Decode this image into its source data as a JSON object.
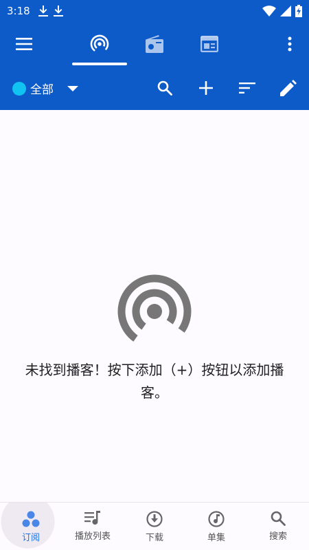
{
  "status_bar": {
    "time": "3:18",
    "icons": [
      "download-icon",
      "download-icon",
      "wifi-icon",
      "signal-icon",
      "battery-charging-icon"
    ]
  },
  "top_tabs": [
    {
      "icon": "podcast-icon",
      "selected": true
    },
    {
      "icon": "radio-icon",
      "selected": false
    },
    {
      "icon": "episodes-icon",
      "selected": false
    }
  ],
  "filter": {
    "label": "全部",
    "dot_color": "#11c3f0"
  },
  "toolbar_actions": [
    "search-icon",
    "add-icon",
    "sort-icon",
    "edit-icon"
  ],
  "empty_state": {
    "message": "未找到播客！按下添加（+）按钮以添加播客。"
  },
  "bottom_nav": [
    {
      "label": "订阅",
      "icon": "subscriptions-icon",
      "active": true
    },
    {
      "label": "播放列表",
      "icon": "playlist-icon",
      "active": false
    },
    {
      "label": "下载",
      "icon": "download-circle-icon",
      "active": false
    },
    {
      "label": "单集",
      "icon": "music-note-icon",
      "active": false
    },
    {
      "label": "搜索",
      "icon": "search-icon",
      "active": false
    }
  ],
  "colors": {
    "primary": "#0d5bc9",
    "accent": "#1a73e8",
    "background": "#fdfbff"
  }
}
